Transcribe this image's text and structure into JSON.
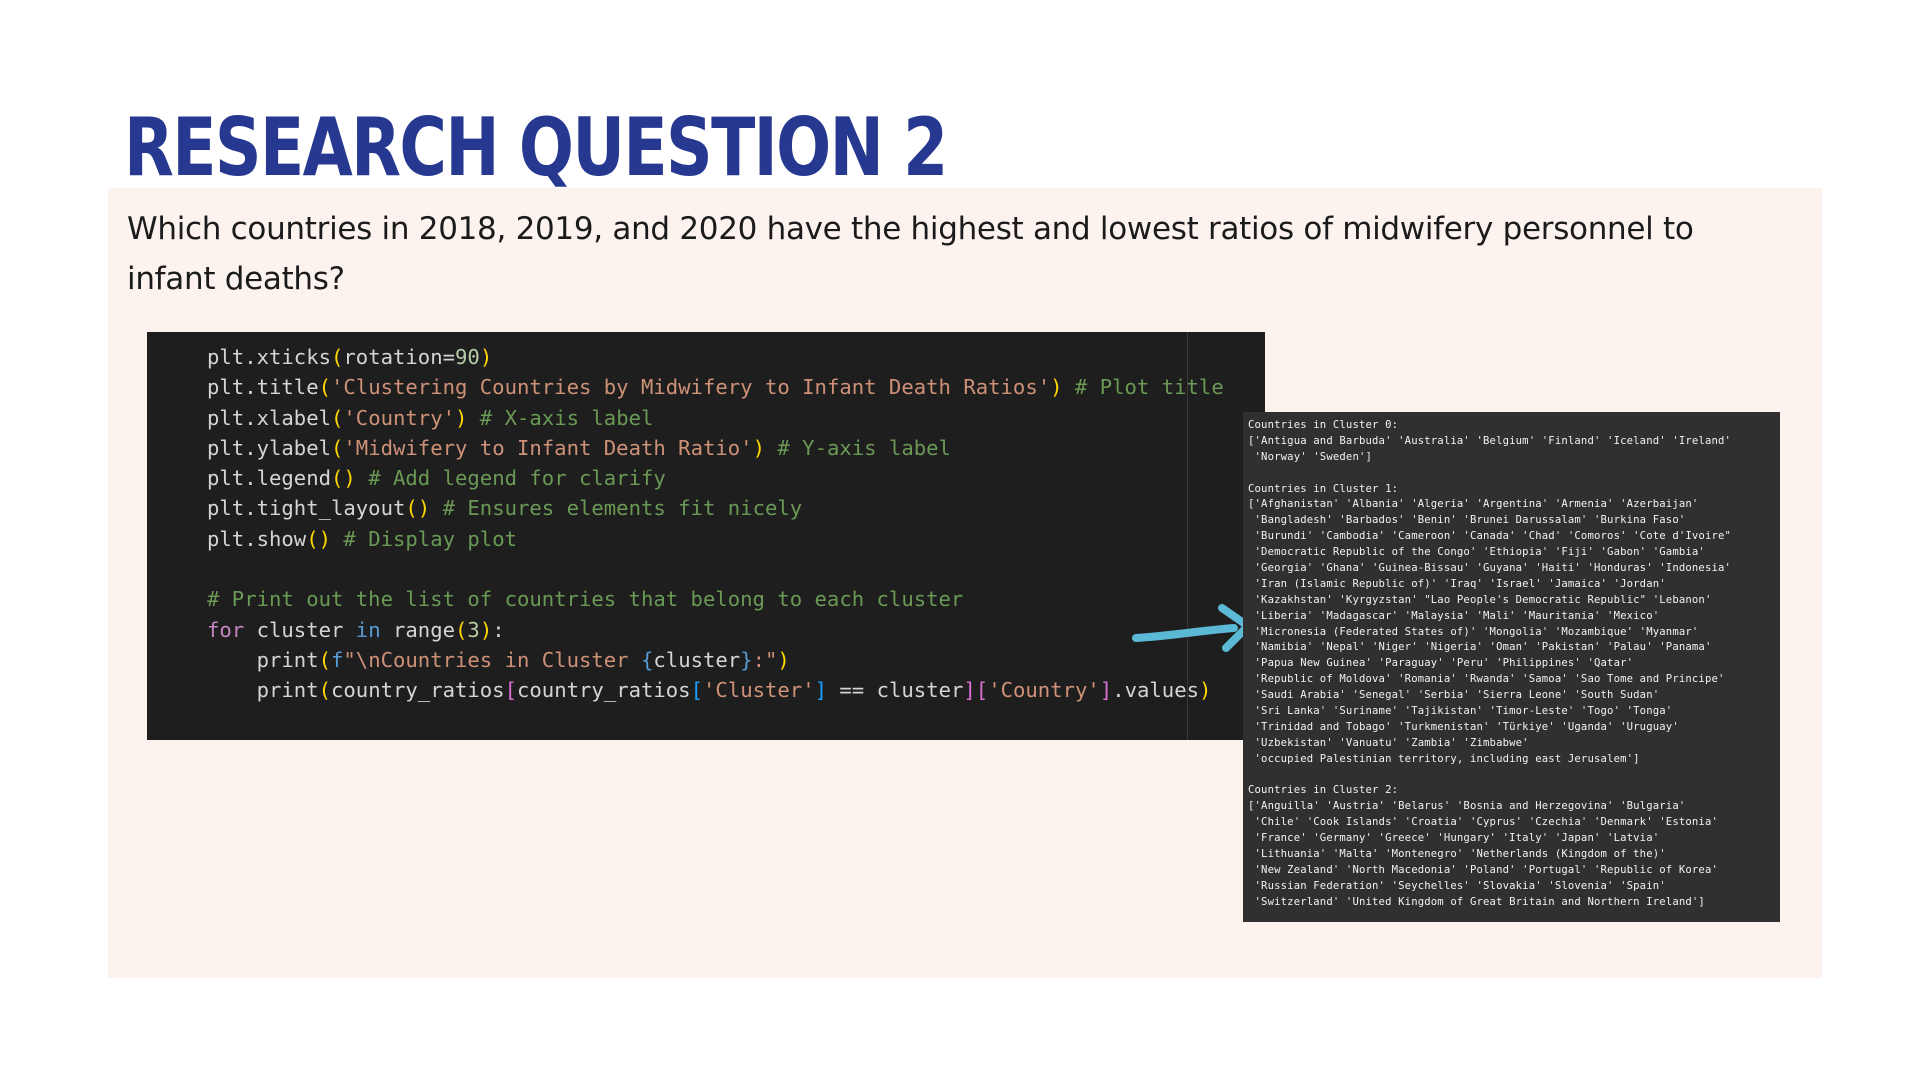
{
  "slide": {
    "title": "RESEARCH QUESTION 2",
    "question": "Which countries in 2018, 2019, and 2020 have the highest and lowest ratios of midwifery personnel to infant deaths?"
  },
  "colors": {
    "title": "#26388f",
    "panel_background": "#fdf3ee",
    "arrow": "#5bb9d6",
    "code_background": "#1e1e1e",
    "output_background": "#303030"
  },
  "code": {
    "lines": [
      [
        {
          "c": "default",
          "t": "plt.xticks"
        },
        {
          "c": "br1",
          "t": "("
        },
        {
          "c": "default",
          "t": "rotation="
        },
        {
          "c": "num",
          "t": "90"
        },
        {
          "c": "br1",
          "t": ")"
        }
      ],
      [
        {
          "c": "default",
          "t": "plt.title"
        },
        {
          "c": "br1",
          "t": "("
        },
        {
          "c": "str",
          "t": "'Clustering Countries by Midwifery to Infant Death Ratios'"
        },
        {
          "c": "br1",
          "t": ")"
        },
        {
          "c": "cmt",
          "t": " # Plot title"
        }
      ],
      [
        {
          "c": "default",
          "t": "plt.xlabel"
        },
        {
          "c": "br1",
          "t": "("
        },
        {
          "c": "str",
          "t": "'Country'"
        },
        {
          "c": "br1",
          "t": ")"
        },
        {
          "c": "cmt",
          "t": " # X-axis label"
        }
      ],
      [
        {
          "c": "default",
          "t": "plt.ylabel"
        },
        {
          "c": "br1",
          "t": "("
        },
        {
          "c": "str",
          "t": "'Midwifery to Infant Death Ratio'"
        },
        {
          "c": "br1",
          "t": ")"
        },
        {
          "c": "cmt",
          "t": " # Y-axis label"
        }
      ],
      [
        {
          "c": "default",
          "t": "plt.legend"
        },
        {
          "c": "br1",
          "t": "()"
        },
        {
          "c": "cmt",
          "t": " # Add legend for clarify"
        }
      ],
      [
        {
          "c": "default",
          "t": "plt.tight_layout"
        },
        {
          "c": "br1",
          "t": "()"
        },
        {
          "c": "cmt",
          "t": " # Ensures elements fit nicely"
        }
      ],
      [
        {
          "c": "default",
          "t": "plt.show"
        },
        {
          "c": "br1",
          "t": "()"
        },
        {
          "c": "cmt",
          "t": " # Display plot"
        }
      ],
      [],
      [
        {
          "c": "cmt",
          "t": "# Print out the list of countries that belong to each cluster"
        }
      ],
      [
        {
          "c": "flow",
          "t": "for"
        },
        {
          "c": "default",
          "t": " cluster "
        },
        {
          "c": "kw",
          "t": "in"
        },
        {
          "c": "default",
          "t": " range"
        },
        {
          "c": "br1",
          "t": "("
        },
        {
          "c": "num",
          "t": "3"
        },
        {
          "c": "br1",
          "t": ")"
        },
        {
          "c": "default",
          "t": ":"
        }
      ],
      [
        {
          "c": "default",
          "t": "    print"
        },
        {
          "c": "br1",
          "t": "("
        },
        {
          "c": "kw",
          "t": "f"
        },
        {
          "c": "str",
          "t": "\"\\nCountries in Cluster "
        },
        {
          "c": "kw",
          "t": "{"
        },
        {
          "c": "default",
          "t": "cluster"
        },
        {
          "c": "kw",
          "t": "}"
        },
        {
          "c": "str",
          "t": ":\""
        },
        {
          "c": "br1",
          "t": ")"
        }
      ],
      [
        {
          "c": "default",
          "t": "    print"
        },
        {
          "c": "br1",
          "t": "("
        },
        {
          "c": "default",
          "t": "country_ratios"
        },
        {
          "c": "br2",
          "t": "["
        },
        {
          "c": "default",
          "t": "country_ratios"
        },
        {
          "c": "br3",
          "t": "["
        },
        {
          "c": "str",
          "t": "'Cluster'"
        },
        {
          "c": "br3",
          "t": "]"
        },
        {
          "c": "default",
          "t": " == cluster"
        },
        {
          "c": "br2",
          "t": "]["
        },
        {
          "c": "str",
          "t": "'Country'"
        },
        {
          "c": "br2",
          "t": "]"
        },
        {
          "c": "default",
          "t": ".values"
        },
        {
          "c": "br1",
          "t": ")"
        }
      ]
    ]
  },
  "output": {
    "lines": [
      "Countries in Cluster 0:",
      "['Antigua and Barbuda' 'Australia' 'Belgium' 'Finland' 'Iceland' 'Ireland'",
      " 'Norway' 'Sweden']",
      "",
      "Countries in Cluster 1:",
      "['Afghanistan' 'Albania' 'Algeria' 'Argentina' 'Armenia' 'Azerbaijan'",
      " 'Bangladesh' 'Barbados' 'Benin' 'Brunei Darussalam' 'Burkina Faso'",
      " 'Burundi' 'Cambodia' 'Cameroon' 'Canada' 'Chad' 'Comoros' 'Cote d'Ivoire\"",
      " 'Democratic Republic of the Congo' 'Ethiopia' 'Fiji' 'Gabon' 'Gambia'",
      " 'Georgia' 'Ghana' 'Guinea-Bissau' 'Guyana' 'Haiti' 'Honduras' 'Indonesia'",
      " 'Iran (Islamic Republic of)' 'Iraq' 'Israel' 'Jamaica' 'Jordan'",
      " 'Kazakhstan' 'Kyrgyzstan' \"Lao People's Democratic Republic\" 'Lebanon'",
      " 'Liberia' 'Madagascar' 'Malaysia' 'Mali' 'Mauritania' 'Mexico'",
      " 'Micronesia (Federated States of)' 'Mongolia' 'Mozambique' 'Myanmar'",
      " 'Namibia' 'Nepal' 'Niger' 'Nigeria' 'Oman' 'Pakistan' 'Palau' 'Panama'",
      " 'Papua New Guinea' 'Paraguay' 'Peru' 'Philippines' 'Qatar'",
      " 'Republic of Moldova' 'Romania' 'Rwanda' 'Samoa' 'Sao Tome and Principe'",
      " 'Saudi Arabia' 'Senegal' 'Serbia' 'Sierra Leone' 'South Sudan'",
      " 'Sri Lanka' 'Suriname' 'Tajikistan' 'Timor-Leste' 'Togo' 'Tonga'",
      " 'Trinidad and Tobago' 'Turkmenistan' 'Türkiye' 'Uganda' 'Uruguay'",
      " 'Uzbekistan' 'Vanuatu' 'Zambia' 'Zimbabwe'",
      " 'occupied Palestinian territory, including east Jerusalem']",
      "",
      "Countries in Cluster 2:",
      "['Anguilla' 'Austria' 'Belarus' 'Bosnia and Herzegovina' 'Bulgaria'",
      " 'Chile' 'Cook Islands' 'Croatia' 'Cyprus' 'Czechia' 'Denmark' 'Estonia'",
      " 'France' 'Germany' 'Greece' 'Hungary' 'Italy' 'Japan' 'Latvia'",
      " 'Lithuania' 'Malta' 'Montenegro' 'Netherlands (Kingdom of the)'",
      " 'New Zealand' 'North Macedonia' 'Poland' 'Portugal' 'Republic of Korea'",
      " 'Russian Federation' 'Seychelles' 'Slovakia' 'Slovenia' 'Spain'",
      " 'Switzerland' 'United Kingdom of Great Britain and Northern Ireland']"
    ]
  }
}
